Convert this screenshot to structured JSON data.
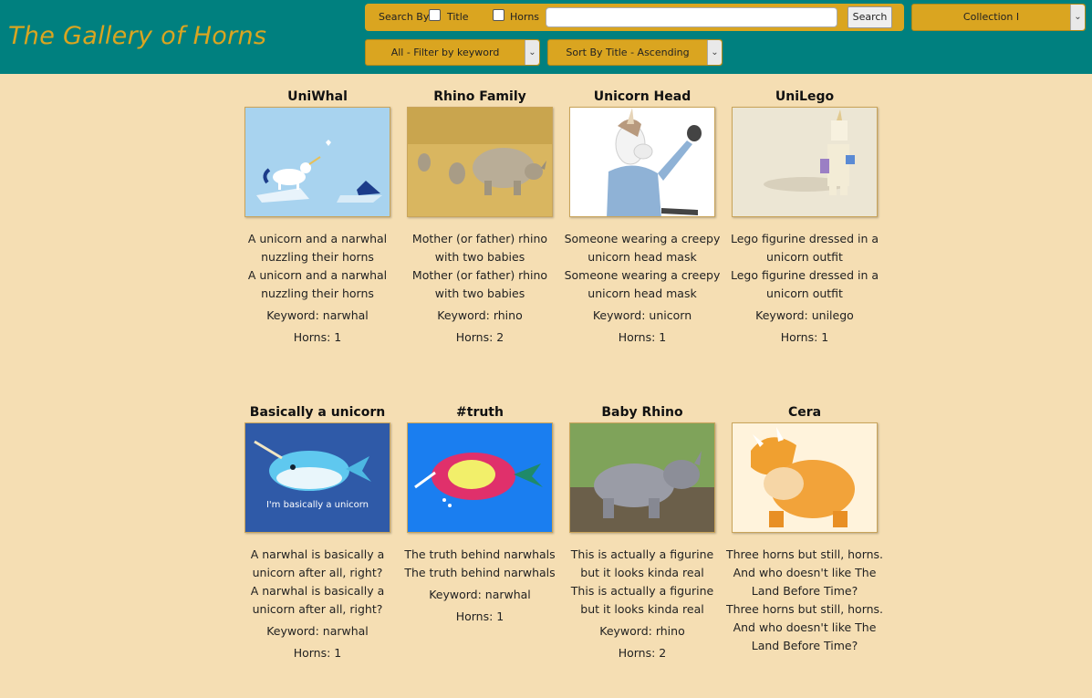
{
  "header": {
    "title": "The Gallery of Horns",
    "search_by_label": "Search By:",
    "title_label": "Title",
    "horns_label": "Horns",
    "search_button": "Search",
    "collection_select": "Collection I",
    "filter_select": "All - Filter by keyword",
    "sort_select": "Sort By Title - Ascending",
    "accent": "#daa520",
    "bar_color": "#00807f"
  },
  "cards": [
    {
      "title": "UniWhal",
      "desc": "A unicorn and a narwhal nuzzling their horns",
      "keyword": "Keyword: narwhal",
      "horns": "Horns: 1",
      "image": "unicorn-narwhal-illustration"
    },
    {
      "title": "Rhino Family",
      "desc": "Mother (or father) rhino with two babies",
      "keyword": "Keyword: rhino",
      "horns": "Horns: 2",
      "image": "rhino-family-photo"
    },
    {
      "title": "Unicorn Head",
      "desc": "Someone wearing a creepy unicorn head mask",
      "keyword": "Keyword: unicorn",
      "horns": "Horns: 1",
      "image": "unicorn-mask-photo"
    },
    {
      "title": "UniLego",
      "desc": "Lego figurine dressed in a unicorn outfit",
      "keyword": "Keyword: unilego",
      "horns": "Horns: 1",
      "image": "lego-unicorn-photo"
    },
    {
      "title": "Basically a unicorn",
      "desc": "A narwhal is basically a unicorn after all, right?",
      "keyword": "Keyword: narwhal",
      "horns": "Horns: 1",
      "image": "narwhal-cartoon",
      "image_caption": "I'm basically a unicorn"
    },
    {
      "title": "#truth",
      "desc": "The truth behind narwhals",
      "keyword": "Keyword: narwhal",
      "horns": "Horns: 1",
      "image": "narwhal-unicorn-cartoon"
    },
    {
      "title": "Baby Rhino",
      "desc": "This is actually a figurine but it looks kinda real",
      "keyword": "Keyword: rhino",
      "horns": "Horns: 2",
      "image": "baby-rhino-photo"
    },
    {
      "title": "Cera",
      "desc": "Three horns but still, horns. And who doesn't like The Land Before Time?",
      "keyword": "",
      "horns": "",
      "image": "triceratops-cartoon"
    }
  ]
}
